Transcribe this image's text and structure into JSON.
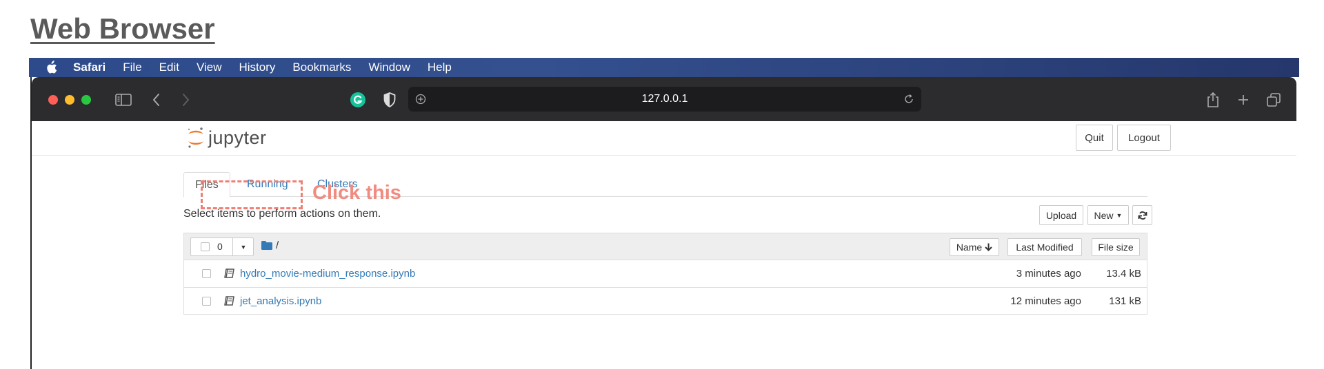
{
  "page_title": "Web Browser",
  "menubar": {
    "app": "Safari",
    "items": [
      "File",
      "Edit",
      "View",
      "History",
      "Bookmarks",
      "Window",
      "Help"
    ]
  },
  "browser": {
    "url": "127.0.0.1",
    "icons": [
      "sidebar-icon",
      "back-icon",
      "forward-icon",
      "grammarly-icon",
      "shield-icon",
      "share-icon",
      "new-tab-icon",
      "tabs-overview-icon"
    ]
  },
  "jupyter": {
    "logo_text": "jupyter",
    "quit_label": "Quit",
    "logout_label": "Logout",
    "tabs": [
      "Files",
      "Running",
      "Clusters"
    ],
    "select_text": "Select items to perform actions on them.",
    "upload_label": "Upload",
    "new_label": "New",
    "selected_count": "0",
    "breadcrumb": "/",
    "columns": {
      "name": "Name",
      "last_modified": "Last Modified",
      "file_size": "File size"
    },
    "files": [
      {
        "name": "hydro_movie-medium_response.ipynb",
        "modified": "3 minutes ago",
        "size": "13.4 kB"
      },
      {
        "name": "jet_analysis.ipynb",
        "modified": "12 minutes ago",
        "size": "131 kB"
      }
    ]
  },
  "annotation": {
    "label": "Click this",
    "color": "#f28b7f"
  },
  "colors": {
    "link": "#337ab7",
    "menubar": "#2d4a8a",
    "toolbar": "#2c2c2e"
  }
}
